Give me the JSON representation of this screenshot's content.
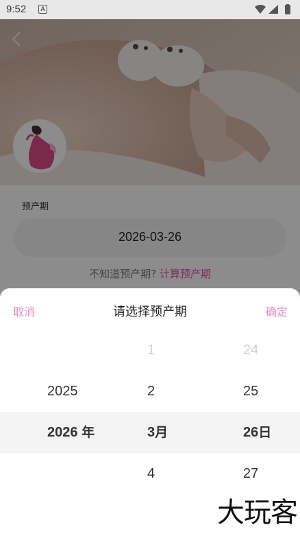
{
  "status_bar": {
    "time": "9:52",
    "notification_icon": "A",
    "icons": [
      "wifi-icon",
      "signal-icon",
      "battery-icon"
    ]
  },
  "page": {
    "back_icon": "chevron-left-icon",
    "field_label": "预产期",
    "date_value": "2026-03-26",
    "hint_text": "不知道预产期?",
    "hint_link": "计算预产期"
  },
  "picker": {
    "cancel_label": "取消",
    "title": "请选择预产期",
    "confirm_label": "确定",
    "years": {
      "prev": "2025",
      "selected": "2026",
      "unit": "年"
    },
    "months": {
      "faded": "1",
      "prev": "2",
      "selected": "3",
      "unit": "月",
      "next": "4"
    },
    "days": {
      "faded": "24",
      "prev": "25",
      "selected": "26",
      "unit": "日",
      "next": "27"
    }
  },
  "watermark": "大玩客",
  "colors": {
    "accent": "#e58ac4",
    "link": "#e4549a",
    "overlay": "rgba(0,0,0,0.45)"
  }
}
